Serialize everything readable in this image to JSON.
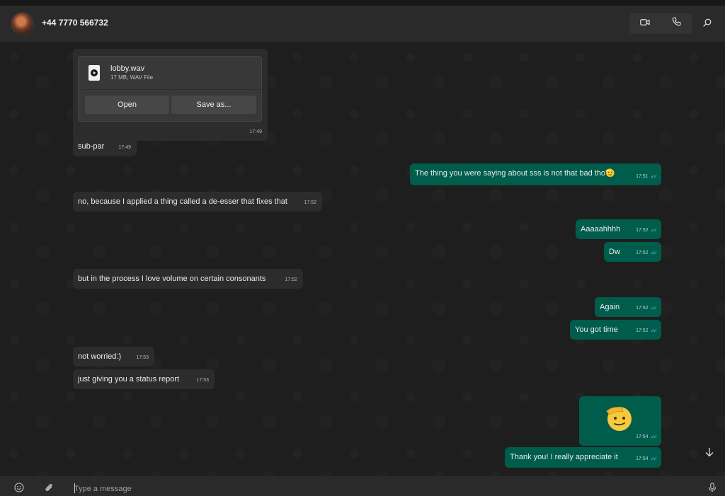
{
  "header": {
    "contact": "+44 7770 566732",
    "video_icon": "video-call-icon",
    "phone_icon": "phone-call-icon",
    "search_icon": "search-icon"
  },
  "file_attachment": {
    "name": "lobby.wav",
    "meta": "17 MB, WAV File",
    "open_label": "Open",
    "save_label": "Save as...",
    "time": "17:49"
  },
  "messages": [
    {
      "dir": "in",
      "text": "sub-par",
      "time": "17:49"
    },
    {
      "dir": "out",
      "text": "The thing you were saying about sss is not that bad tho🫡",
      "time": "17:51"
    },
    {
      "dir": "in",
      "text": "no, because I applied a thing called a de-esser that fixes that",
      "time": "17:52"
    },
    {
      "dir": "out",
      "text": "Aaaaahhhh",
      "time": "17:52"
    },
    {
      "dir": "out",
      "text": "Dw",
      "time": "17:52"
    },
    {
      "dir": "in",
      "text": "but in the process I love volume on certain consonants",
      "time": "17:52"
    },
    {
      "dir": "out",
      "text": "Again",
      "time": "17:52"
    },
    {
      "dir": "out",
      "text": "You got time",
      "time": "17:52"
    },
    {
      "dir": "in",
      "text": "not worried:)",
      "time": "17:53"
    },
    {
      "dir": "in",
      "text": "just giving you a status report",
      "time": "17:53"
    },
    {
      "dir": "out",
      "text": "",
      "emoji": "salute-face",
      "time": "17:54"
    },
    {
      "dir": "out",
      "text": "Thank you! I really appreciate it",
      "time": "17:54"
    }
  ],
  "composer": {
    "placeholder": "Type a message",
    "emoji_icon": "emoji-icon",
    "attach_icon": "paperclip-icon",
    "mic_icon": "microphone-icon"
  },
  "colors": {
    "incoming": "#2c2c2c",
    "outgoing": "#005c4b",
    "read_ticks": "#53bdeb",
    "background": "#1e1e1e"
  }
}
